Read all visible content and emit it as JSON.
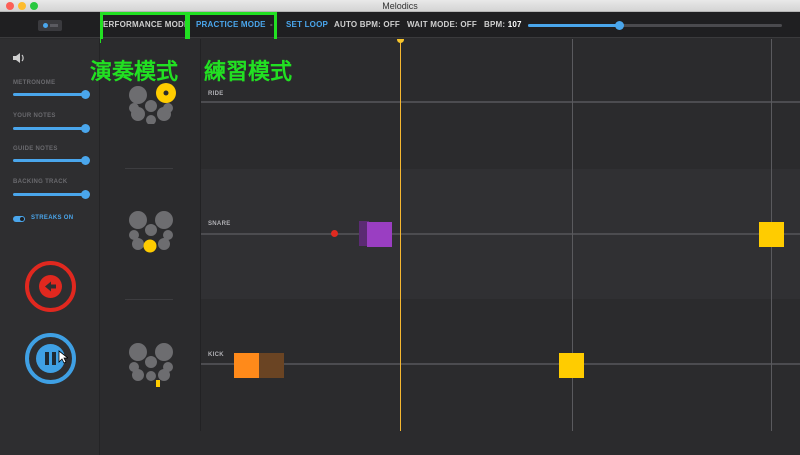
{
  "window": {
    "title": "Melodics"
  },
  "toolbar": {
    "performance_mode": "ERFORMANCE MODE",
    "practice_mode": "PRACTICE MODE",
    "mode_separator": "-",
    "set_loop": "SET LOOP",
    "auto_bpm_label": "AUTO BPM:",
    "auto_bpm_value": "OFF",
    "wait_mode_label": "WAIT MODE:",
    "wait_mode_value": "OFF",
    "bpm_label": "BPM:",
    "bpm_value": "107",
    "bpm_slider_level": 0.36
  },
  "annotations": {
    "performance_caption": "演奏模式",
    "practice_caption": "練習模式",
    "highlight_color": "#22e022"
  },
  "sidebar": {
    "volume_icon": "speaker-icon",
    "sliders": [
      {
        "label": "METRONOME",
        "level": 1.0
      },
      {
        "label": "YOUR NOTES",
        "level": 1.0
      },
      {
        "label": "GUIDE NOTES",
        "level": 1.0
      },
      {
        "label": "BACKING TRACK",
        "level": 1.0
      }
    ],
    "streaks_label": "STREAKS ON",
    "streaks_on": true,
    "back_icon": "back-arrow-icon",
    "pause_icon": "pause-icon"
  },
  "lanes": [
    {
      "label": "RIDE",
      "drum_icon": "drum-kit-ride-icon"
    },
    {
      "label": "SNARE",
      "drum_icon": "drum-kit-snare-icon"
    },
    {
      "label": "KICK",
      "drum_icon": "drum-kit-kick-icon"
    }
  ],
  "colors": {
    "accent": "#4aa6ec",
    "playhead": "#f5b730",
    "note_yellow": "#ffcc00",
    "note_purple": "#9a3ec2",
    "note_orange": "#ff8a1a",
    "miss_red": "#e0281f"
  }
}
